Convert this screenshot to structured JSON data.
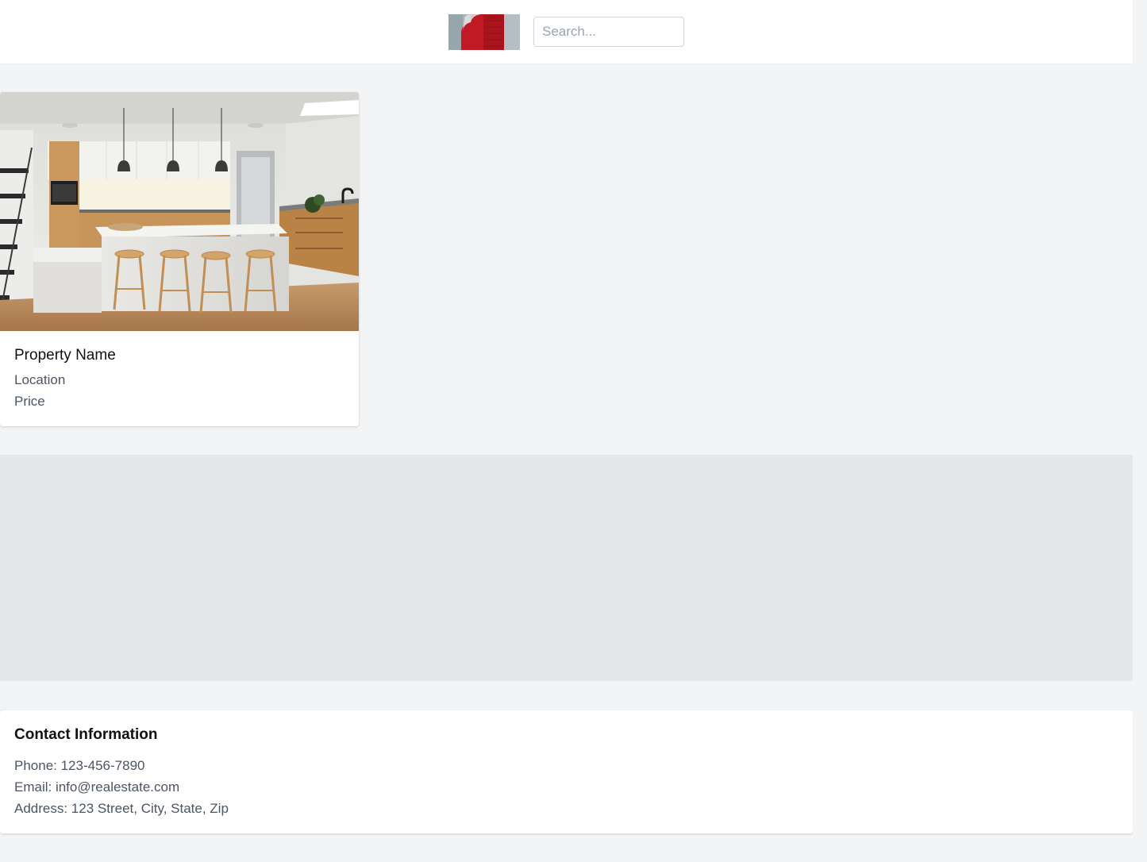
{
  "header": {
    "logo": {
      "icon": "brand-logo-icon",
      "colors": {
        "background": "#a7b3b6",
        "accent": "#c21a24"
      }
    },
    "search": {
      "placeholder": "Search...",
      "value": ""
    }
  },
  "listings": [
    {
      "image": {
        "icon": "kitchen-photo"
      },
      "name": "Property Name",
      "location": "Location",
      "price": "Price"
    }
  ],
  "contact": {
    "title": "Contact Information",
    "phone": "Phone: 123-456-7890",
    "email": "Email: info@realestate.com",
    "address": "Address: 123 Street, City, State, Zip"
  },
  "colors": {
    "page_background": "#f3f4f6",
    "band_background": "#e5e7eb",
    "card_background": "#ffffff",
    "heading_text": "#111111",
    "body_text": "#4b5563"
  }
}
